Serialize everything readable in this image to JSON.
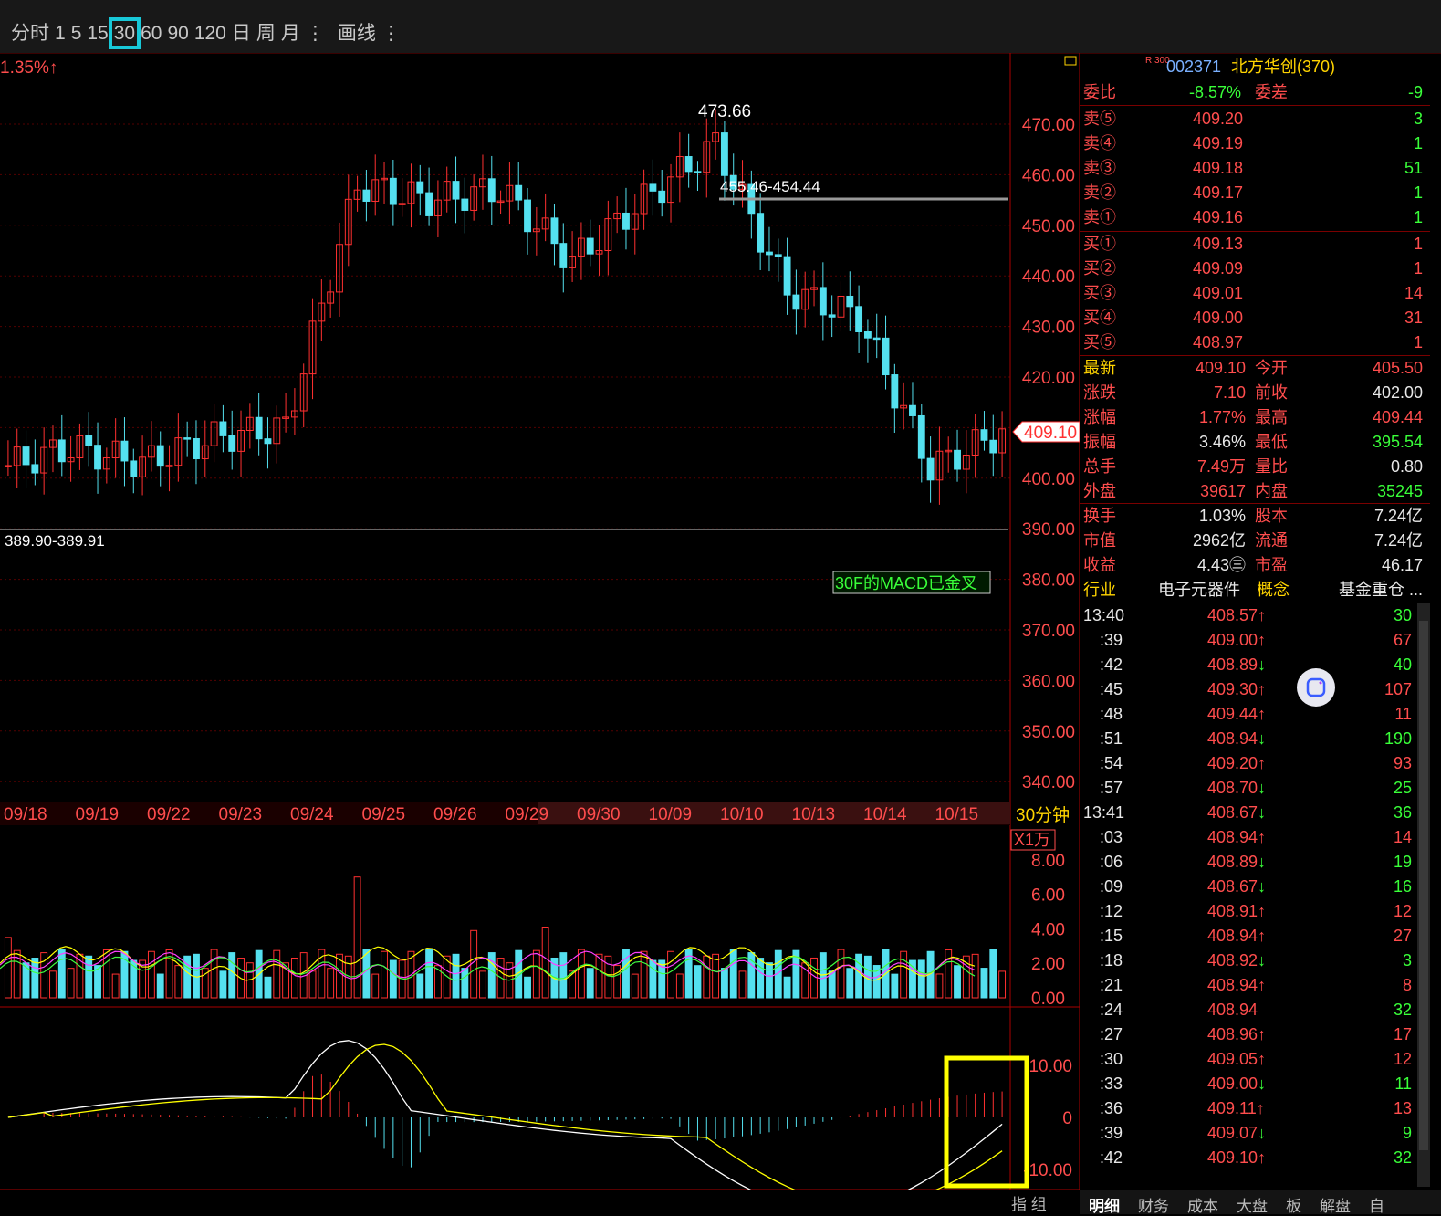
{
  "toolbar": {
    "items": [
      "分时",
      "1",
      "5",
      "15",
      "30",
      "60",
      "90",
      "120",
      "日",
      "周",
      "月",
      "⋮",
      "画线",
      "⋮"
    ],
    "active": "30"
  },
  "chart_header": {
    "change_pct": "1.35%↑"
  },
  "price_axis": [
    "470.00",
    "460.00",
    "450.00",
    "440.00",
    "430.00",
    "420.00",
    "410.00",
    "400.00",
    "390.00",
    "380.00",
    "370.00",
    "360.00",
    "350.00",
    "340.00"
  ],
  "current_price_tag": "409.10",
  "annotations": {
    "high": "473.66",
    "resistance": "455.46-454.44",
    "support": "389.90-389.91",
    "macd_alert": "30F的MACD已金叉"
  },
  "date_axis": [
    "09/18",
    "09/19",
    "09/22",
    "09/23",
    "09/24",
    "09/25",
    "09/26",
    "09/29",
    "09/30",
    "10/09",
    "10/10",
    "10/13",
    "10/14",
    "10/15"
  ],
  "period_label": "30分钟",
  "volume_panel": {
    "unit": "X1万",
    "axis": [
      "8.00",
      "6.00",
      "4.00",
      "2.00",
      "0.00"
    ]
  },
  "macd_panel": {
    "axis": [
      "10.00",
      "0",
      "-10.00"
    ]
  },
  "colors": {
    "up": "#ff3030",
    "down": "#54e0ef",
    "ma_white": "#ffffff",
    "ma_yellow": "#ffff00",
    "ma_magenta": "#ff40ff",
    "ma_green": "#40ff40",
    "highlight": "#ffff00",
    "active_tf": "#18c8d8"
  },
  "chart_data": {
    "type": "candlestick",
    "x": [
      "09/18",
      "09/19",
      "09/22",
      "09/23",
      "09/24",
      "09/25",
      "09/26",
      "09/29",
      "09/30",
      "10/09",
      "10/10",
      "10/13",
      "10/14",
      "10/15"
    ],
    "close": [
      406,
      403,
      408,
      410,
      458,
      455,
      457,
      443,
      455,
      466,
      437,
      432,
      402,
      409.1
    ],
    "volume": [
      2.0,
      2.2,
      1.8,
      2.5,
      5.5,
      8.1,
      2.4,
      2.6,
      2.8,
      2.5,
      2.7,
      2.3,
      2.6,
      1.5
    ],
    "ylim": [
      340,
      475
    ]
  },
  "right_panel": {
    "stock_code": "002371",
    "stock_name": "北方华创(370)",
    "board_badge": "R 300",
    "weibi": {
      "label": "委比",
      "value": "-8.57%",
      "label2": "委差",
      "value2": "-9"
    },
    "asks": [
      {
        "label": "卖⑤",
        "price": "409.20",
        "vol": "3"
      },
      {
        "label": "卖④",
        "price": "409.19",
        "vol": "1"
      },
      {
        "label": "卖③",
        "price": "409.18",
        "vol": "51"
      },
      {
        "label": "卖②",
        "price": "409.17",
        "vol": "1"
      },
      {
        "label": "卖①",
        "price": "409.16",
        "vol": "1"
      }
    ],
    "bids": [
      {
        "label": "买①",
        "price": "409.13",
        "vol": "1"
      },
      {
        "label": "买②",
        "price": "409.09",
        "vol": "1"
      },
      {
        "label": "买③",
        "price": "409.01",
        "vol": "14"
      },
      {
        "label": "买④",
        "price": "409.00",
        "vol": "31"
      },
      {
        "label": "买⑤",
        "price": "408.97",
        "vol": "1"
      }
    ],
    "quote": [
      {
        "l1": "最新",
        "v1": "409.10",
        "l2": "今开",
        "v2": "405.50"
      },
      {
        "l1": "涨跌",
        "v1": "7.10",
        "l2": "前收",
        "v2": "402.00"
      },
      {
        "l1": "涨幅",
        "v1": "1.77%",
        "l2": "最高",
        "v2": "409.44"
      },
      {
        "l1": "振幅",
        "v1": "3.46%",
        "l2": "最低",
        "v2": "395.54"
      },
      {
        "l1": "总手",
        "v1": "7.49万",
        "l2": "量比",
        "v2": "0.80"
      },
      {
        "l1": "外盘",
        "v1": "39617",
        "l2": "内盘",
        "v2": "35245"
      }
    ],
    "fund": [
      {
        "l1": "换手",
        "v1": "1.03%",
        "l2": "股本",
        "v2": "7.24亿"
      },
      {
        "l1": "市值",
        "v1": "2962亿",
        "l2": "流通",
        "v2": "7.24亿"
      },
      {
        "l1": "收益",
        "v1": "4.43㊂",
        "l2": "市盈",
        "v2": "46.17"
      }
    ],
    "industry": {
      "l1": "行业",
      "v1": "电子元器件",
      "l2": "概念",
      "v2": "基金重仓 ..."
    },
    "ticks": [
      {
        "t": "13:40",
        "p": "408.57↑",
        "v": "30",
        "vc": "green"
      },
      {
        "t": ":39",
        "p": "409.00↑",
        "v": "67",
        "vc": "red"
      },
      {
        "t": ":42",
        "p": "408.89↓",
        "v": "40",
        "vc": "green"
      },
      {
        "t": ":45",
        "p": "409.30↑",
        "v": "107",
        "vc": "red"
      },
      {
        "t": ":48",
        "p": "409.44↑",
        "v": "11",
        "vc": "red"
      },
      {
        "t": ":51",
        "p": "408.94↓",
        "v": "190",
        "vc": "green"
      },
      {
        "t": ":54",
        "p": "409.20↑",
        "v": "93",
        "vc": "red"
      },
      {
        "t": ":57",
        "p": "408.70↓",
        "v": "25",
        "vc": "green"
      },
      {
        "t": "13:41",
        "p": "408.67↓",
        "v": "36",
        "vc": "green"
      },
      {
        "t": ":03",
        "p": "408.94↑",
        "v": "14",
        "vc": "red"
      },
      {
        "t": ":06",
        "p": "408.89↓",
        "v": "19",
        "vc": "green"
      },
      {
        "t": ":09",
        "p": "408.67↓",
        "v": "16",
        "vc": "green"
      },
      {
        "t": ":12",
        "p": "408.91↑",
        "v": "12",
        "vc": "red"
      },
      {
        "t": ":15",
        "p": "408.94↑",
        "v": "27",
        "vc": "red"
      },
      {
        "t": ":18",
        "p": "408.92↓",
        "v": "3",
        "vc": "green"
      },
      {
        "t": ":21",
        "p": "408.94↑",
        "v": "8",
        "vc": "red"
      },
      {
        "t": ":24",
        "p": "408.94",
        "v": "32",
        "vc": "green"
      },
      {
        "t": ":27",
        "p": "408.96↑",
        "v": "17",
        "vc": "red"
      },
      {
        "t": ":30",
        "p": "409.05↑",
        "v": "12",
        "vc": "red"
      },
      {
        "t": ":33",
        "p": "409.00↓",
        "v": "11",
        "vc": "green"
      },
      {
        "t": ":36",
        "p": "409.11↑",
        "v": "13",
        "vc": "red"
      },
      {
        "t": ":39",
        "p": "409.07↓",
        "v": "9",
        "vc": "green"
      },
      {
        "t": ":42",
        "p": "409.10↑",
        "v": "32",
        "vc": "green"
      }
    ],
    "tabs": [
      "明细",
      "财务",
      "成本",
      "大盘",
      "板",
      "解盘",
      "自"
    ],
    "bottom_left": "指 组"
  }
}
